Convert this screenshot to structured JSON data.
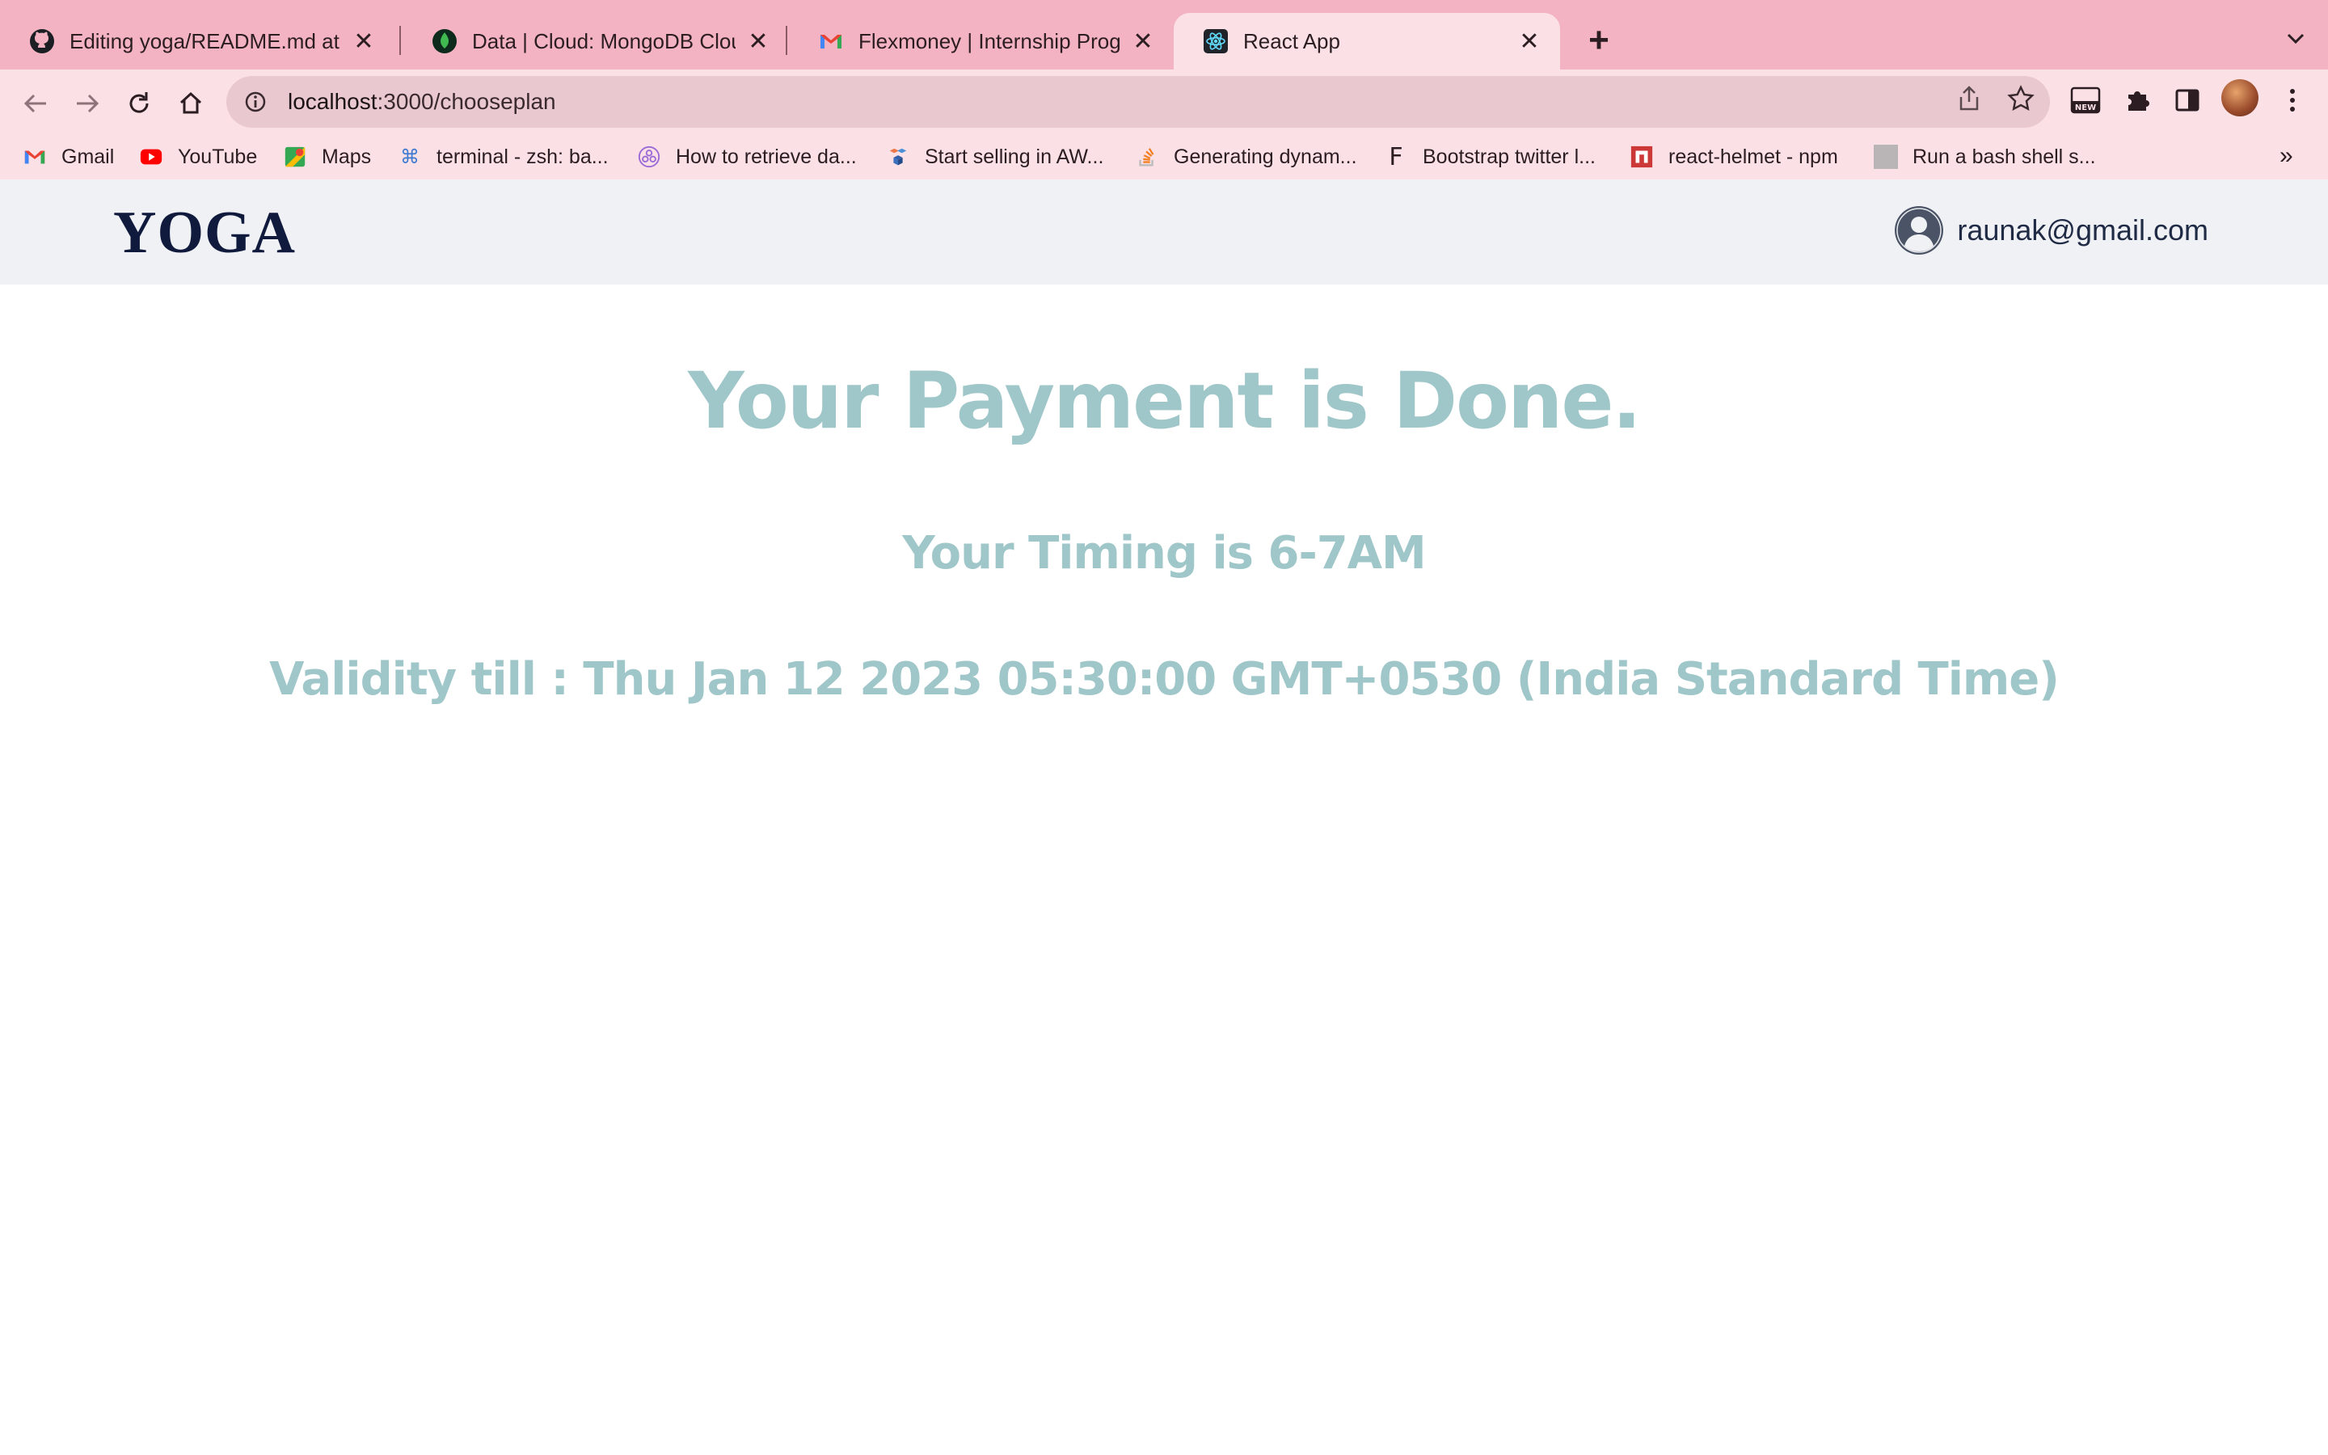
{
  "browser": {
    "tabs": [
      {
        "title": "Editing yoga/README.md at m",
        "icon": "github-icon",
        "active": false
      },
      {
        "title": "Data | Cloud: MongoDB Cloud",
        "icon": "mongodb-leaf-icon",
        "active": false
      },
      {
        "title": "Flexmoney | Internship Progran",
        "icon": "gmail-icon",
        "active": false
      },
      {
        "title": "React App",
        "icon": "react-icon",
        "active": true
      }
    ],
    "address_bar": {
      "host": "localhost",
      "path": ":3000/chooseplan"
    },
    "bookmarks": [
      {
        "label": "Gmail",
        "icon": "gmail-icon"
      },
      {
        "label": "YouTube",
        "icon": "youtube-icon"
      },
      {
        "label": "Maps",
        "icon": "maps-icon"
      },
      {
        "label": "terminal - zsh: ba...",
        "icon": "command-icon"
      },
      {
        "label": "How to retrieve da...",
        "icon": "circles-icon"
      },
      {
        "label": "Start selling in AW...",
        "icon": "aws-cubes-icon"
      },
      {
        "label": "Generating dynam...",
        "icon": "stackoverflow-icon"
      },
      {
        "label": "Bootstrap twitter l...",
        "icon": "f-letter-icon"
      },
      {
        "label": "react-helmet - npm",
        "icon": "npm-icon"
      },
      {
        "label": "Run a bash shell s...",
        "icon": "gray-square-icon"
      }
    ],
    "bookmarks_overflow": "»"
  },
  "header": {
    "brand": "YOGA",
    "user_email": "raunak@gmail.com"
  },
  "main": {
    "headline": "Your Payment is Done.",
    "timing": "Your Timing is 6-7AM",
    "validity": "Validity till : Thu Jan 12 2023 05:30:00 GMT+0530 (India Standard Time)"
  },
  "colors": {
    "tabstrip": "#f3b3c2",
    "toolbar": "#fbe1e6",
    "header_bg": "#f0f1f5",
    "brand": "#0f1a3d",
    "accent_text": "#9fc6c8"
  }
}
